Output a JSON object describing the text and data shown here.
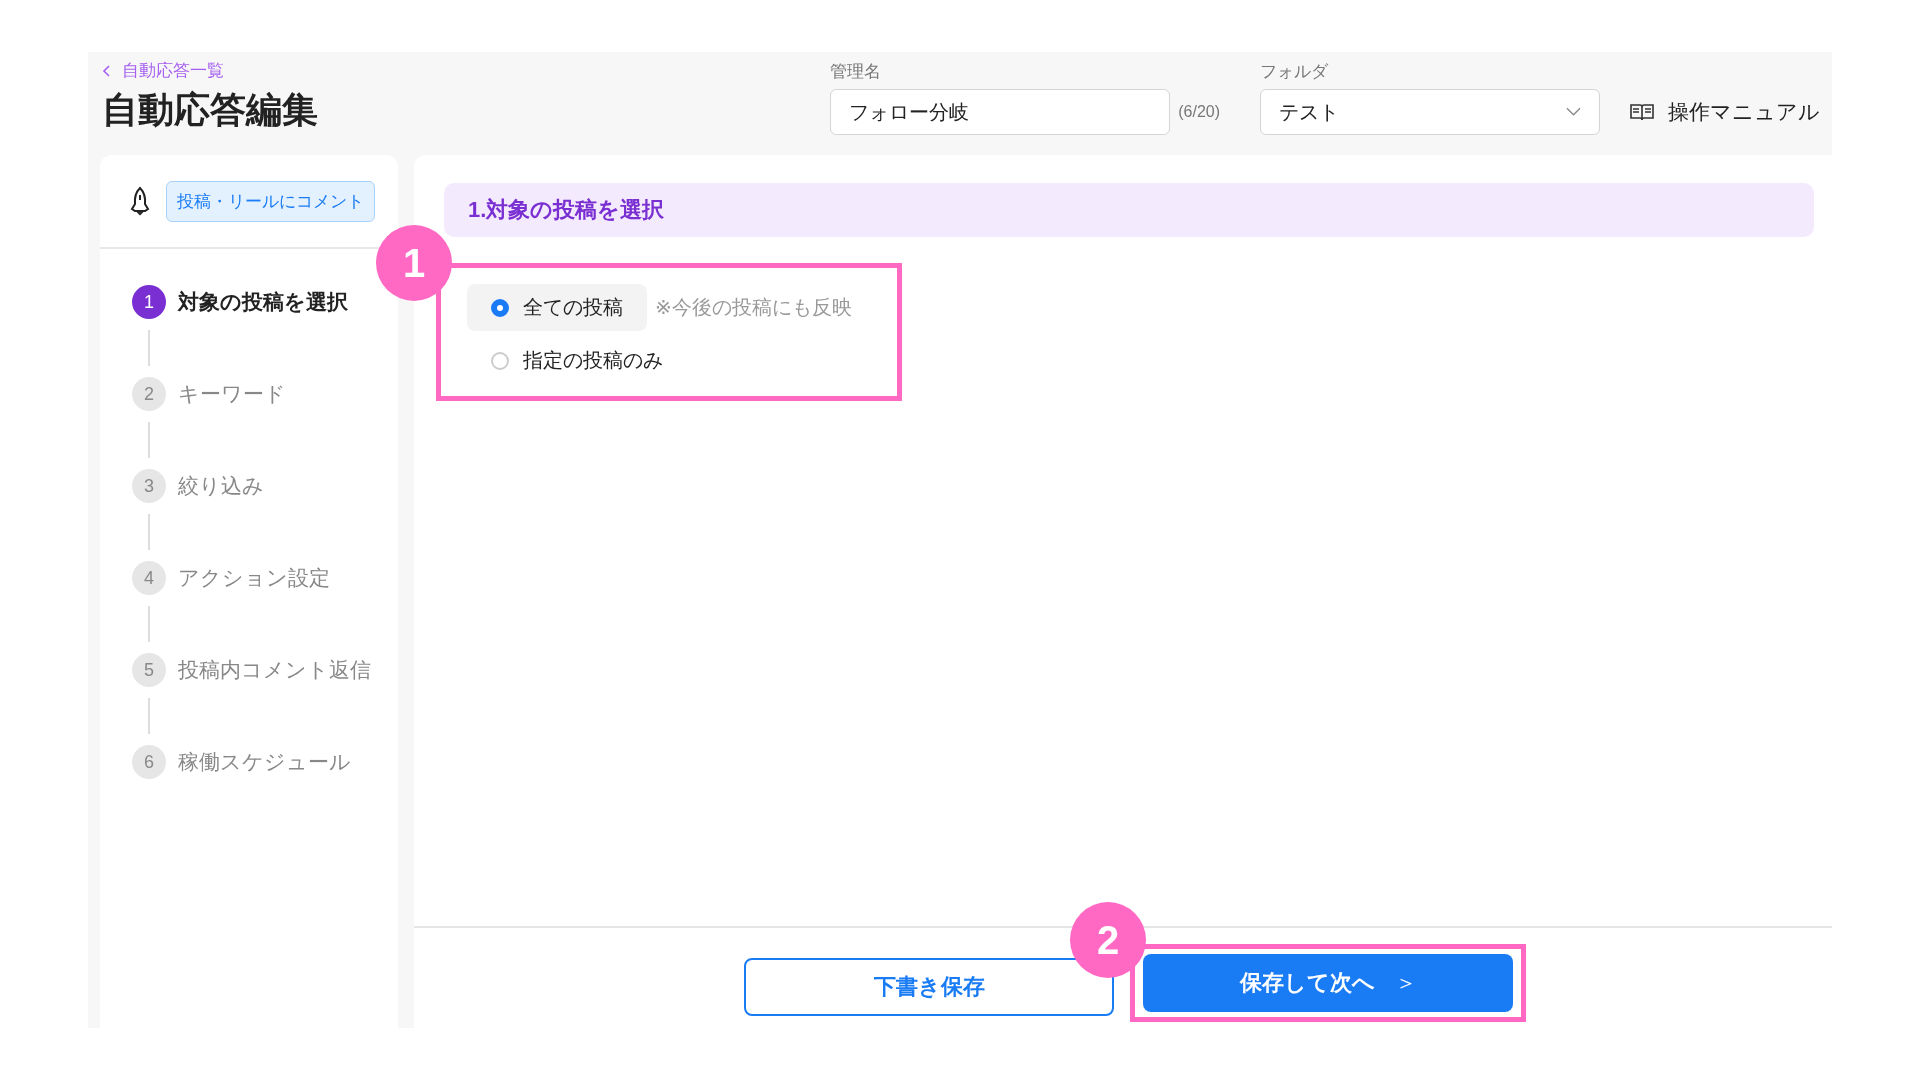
{
  "header": {
    "back_link": "自動応答一覧",
    "title": "自動応答編集",
    "name_field": {
      "label": "管理名",
      "value": "フォロー分岐",
      "counter": "(6/20)"
    },
    "folder_field": {
      "label": "フォルダ",
      "value": "テスト"
    },
    "manual_link": "操作マニュアル"
  },
  "sidebar": {
    "trigger_tag": "投稿・リールにコメント",
    "steps": [
      {
        "number": "1",
        "label": "対象の投稿を選択",
        "selected": true
      },
      {
        "number": "2",
        "label": "キーワード",
        "selected": false
      },
      {
        "number": "3",
        "label": "絞り込み",
        "selected": false
      },
      {
        "number": "4",
        "label": "アクション設定",
        "selected": false
      },
      {
        "number": "5",
        "label": "投稿内コメント返信",
        "selected": false
      },
      {
        "number": "6",
        "label": "稼働スケジュール",
        "selected": false
      }
    ]
  },
  "section": {
    "title": "1.対象の投稿を選択",
    "options": [
      {
        "label": "全ての投稿",
        "note": "※今後の投稿にも反映",
        "selected": true
      },
      {
        "label": "指定の投稿のみ",
        "selected": false
      }
    ]
  },
  "buttons": {
    "draft": "下書き保存",
    "next": "保存して次へ",
    "next_icon": "＞"
  },
  "callouts": [
    "1",
    "2"
  ]
}
